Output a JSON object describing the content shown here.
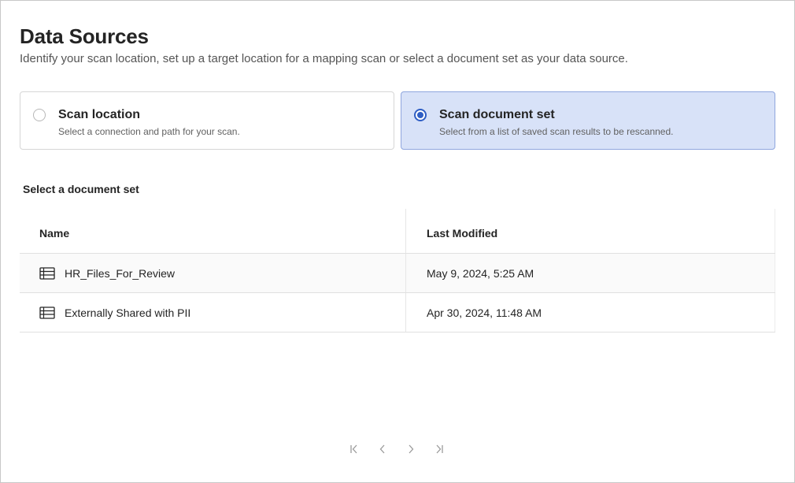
{
  "header": {
    "title": "Data Sources",
    "subtitle": "Identify your scan location, set up a target location for a mapping scan or select a document set as your data source."
  },
  "options": [
    {
      "title": "Scan location",
      "description": "Select a connection and path for your scan.",
      "selected": false
    },
    {
      "title": "Scan document set",
      "description": "Select from a list of saved scan results to be rescanned.",
      "selected": true
    }
  ],
  "section": {
    "label": "Select a document set"
  },
  "table": {
    "columns": [
      "Name",
      "Last Modified"
    ],
    "rows": [
      {
        "name": "HR_Files_For_Review",
        "modified": "May 9, 2024, 5:25 AM"
      },
      {
        "name": "Externally Shared with PII",
        "modified": "Apr 30, 2024, 11:48 AM"
      }
    ]
  },
  "pagination": {
    "icons": [
      "first-page-icon",
      "previous-page-icon",
      "next-page-icon",
      "last-page-icon"
    ]
  },
  "colors": {
    "accent": "#2f5ec4",
    "selected_bg": "#d8e2f8"
  }
}
